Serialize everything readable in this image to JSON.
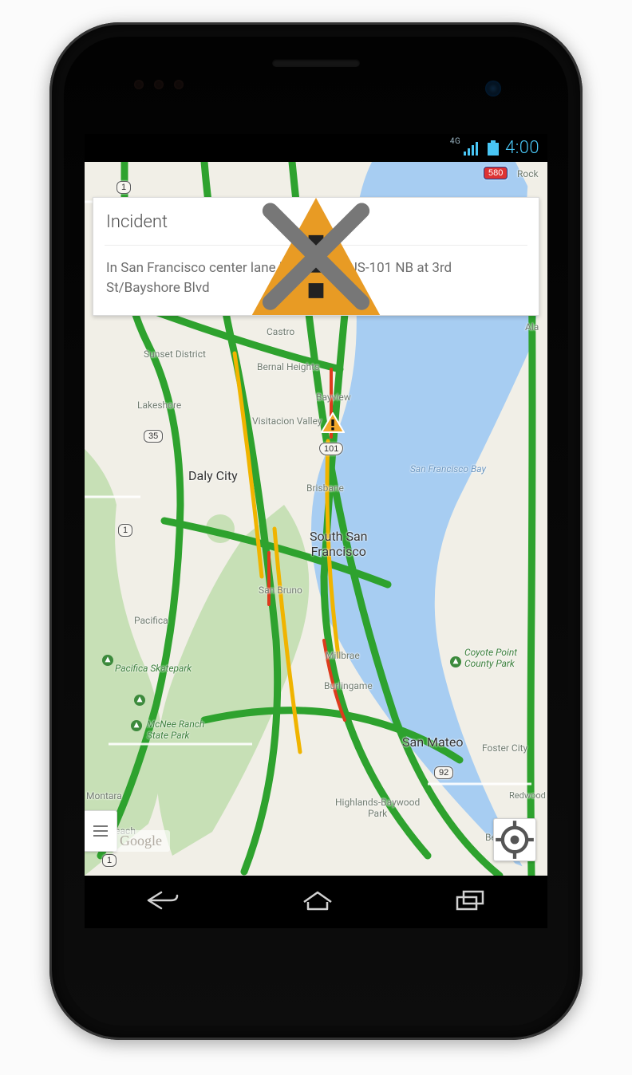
{
  "status": {
    "network": "4G",
    "time": "4:00"
  },
  "card": {
    "title": "Incident",
    "body": "In San Francisco center lane blocked on US-101 NB at 3rd St/Bayshore Blvd"
  },
  "attribution": "Google",
  "labels": {
    "sunset": "Sunset District",
    "castro": "Castro",
    "bernal": "Bernal Heights",
    "lakeshore": "Lakeshore",
    "bayview": "Bayview",
    "visitacion": "Visitacion Valley",
    "daly": "Daly City",
    "brisbane": "Brisbane",
    "ssf": "South San\nFrancisco",
    "sanbruno": "San Bruno",
    "pacifica": "Pacifica",
    "millbrae": "Millbrae",
    "burlingame": "Burlingame",
    "sanmateo": "San Mateo",
    "foster": "Foster City",
    "montara": "Montara",
    "moss": "Moss Beach",
    "highlands": "Highlands-Baywood\nPark",
    "belmont": "Belmont",
    "redwood": "Redwood",
    "rock": "Rock",
    "ala": "Ala",
    "sfbay": "San Francisco Bay",
    "pac_skate": "Pacifica Skatepark",
    "mcnee": "McNee Ranch\nState Park",
    "coyote": "Coyote Point\nCounty Park"
  },
  "shields": {
    "one_a": "1",
    "s35": "35",
    "s101": "101",
    "one_b": "1",
    "one_c": "1",
    "s92": "92",
    "i580": "580"
  }
}
